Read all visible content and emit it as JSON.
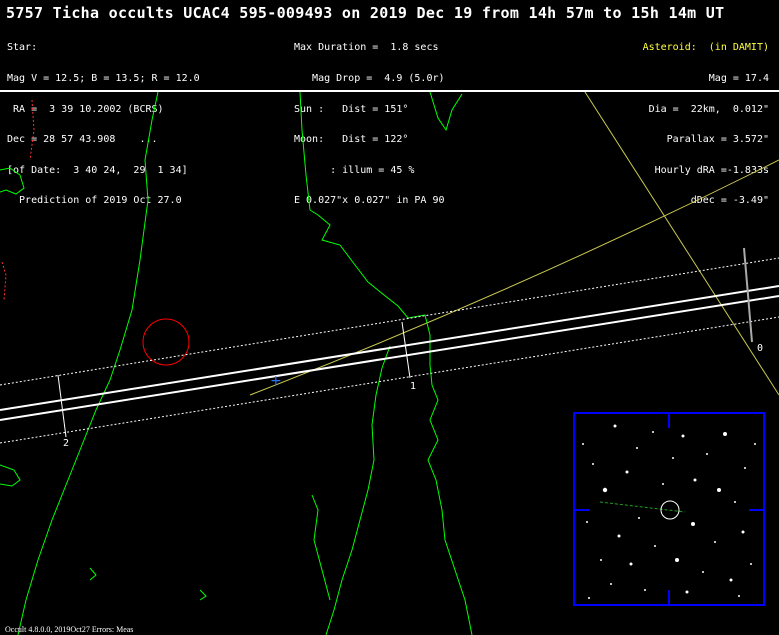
{
  "title": "5757 Ticha occults UCAC4 595-009493 on 2019 Dec 19 from 14h 57m to 15h 14m UT",
  "star": {
    "lines": [
      "Star:",
      "Mag V = 12.5; B = 13.5; R = 12.0",
      " RA =  3 39 10.2002 (BCRS)",
      "Dec = 28 57 43.908    ...",
      "[of Date:  3 40 24,  29  1 34]",
      "  Prediction of 2019 Oct 27.0"
    ]
  },
  "event": {
    "lines": [
      "Max Duration =  1.8 secs",
      "   Mag Drop =  4.9 (5.0r)",
      "Sun :   Dist = 151°",
      "Moon:   Dist = 122°",
      "      : illum = 45 %",
      "E 0.027\"x 0.027\" in PA 90"
    ]
  },
  "asteroid": {
    "header": "Asteroid:  (in DAMIT)",
    "lines": [
      "Mag = 17.4",
      "Dia =  22km,  0.012\"",
      "Parallax = 3.572\"",
      "Hourly dRA =-1.833s",
      "dDec = -3.49\""
    ]
  },
  "path_labels": {
    "p0": "0",
    "p1": "1",
    "p2": "2"
  },
  "footer": "Occult 4.8.0.0, 2019Oct27  Errors: Meas",
  "colors": {
    "coast": "#00ff00",
    "path": "#ffffff",
    "grid": "#c8c850",
    "error_ellipse": "#ff0000",
    "inset_border": "#0000ff",
    "asteroid_header": "#ffff40"
  },
  "icons": {
    "target_marker": "plus-marker-icon",
    "error_circle": "circle-icon"
  }
}
